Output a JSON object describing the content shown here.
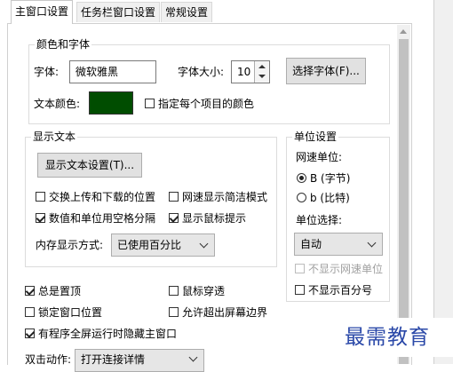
{
  "tabs": [
    "主窗口设置",
    "任务栏窗口设置",
    "常规设置"
  ],
  "color_font": {
    "title": "颜色和字体",
    "font_label": "字体:",
    "font_value": "微软雅黑",
    "size_label": "字体大小:",
    "size_value": "10",
    "choose_font_button": "选择字体(F)...",
    "text_color_label": "文本颜色:",
    "text_color": "#004d00",
    "per_item_color_label": "指定每个项目的颜色"
  },
  "display_text": {
    "title": "显示文本",
    "settings_button": "显示文本设置(T)...",
    "swap_label": "交换上传和下载的位置",
    "simple_mode_label": "网速显示简洁模式",
    "space_sep_label": "数值和单位用空格分隔",
    "mouse_tip_label": "显示鼠标提示",
    "memory_mode_label": "内存显示方式:",
    "memory_mode_value": "已使用百分比"
  },
  "unit": {
    "title": "单位设置",
    "speed_unit_label": "网速单位:",
    "byte_option": "B (字节)",
    "bit_option": "b (比特)",
    "unit_select_label": "单位选择:",
    "unit_select_value": "自动",
    "hide_speed_unit_label": "不显示网速单位",
    "hide_percent_label": "不显示百分号"
  },
  "options": {
    "always_on_top": "总是置顶",
    "mouse_through": "鼠标穿透",
    "lock_position": "锁定窗口位置",
    "allow_offscreen": "允许超出屏幕边界",
    "hide_fullscreen": "有程序全屏运行时隐藏主窗口",
    "double_click_label": "双击动作:",
    "double_click_value": "打开连接详情"
  },
  "watermark": "最需教育"
}
